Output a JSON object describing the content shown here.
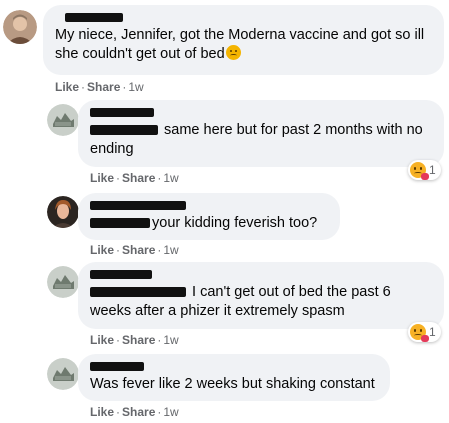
{
  "actions": {
    "like": "Like",
    "share": "Share",
    "separator": "·"
  },
  "comments": [
    {
      "text": "My niece, Jennifer, got the Moderna vaccine and got so ill she couldn't get out of bed",
      "time": "1w"
    },
    {
      "text": "same here but for past 2 months with no ending",
      "time": "1w",
      "reaction_count": "1"
    },
    {
      "text": "your kidding feverish too?",
      "time": "1w"
    },
    {
      "text": "I can't get out of bed the past 6 weeks after a phizer it extremely spasm",
      "time": "1w",
      "reaction_count": "1"
    },
    {
      "text": "Was fever like 2 weeks but shaking constant",
      "time": "1w"
    }
  ],
  "colors": {
    "bubble": "#f0f2f5",
    "meta_text": "#65676b",
    "redaction": "#111111"
  },
  "icons": {
    "reaction": "care-emoji-icon",
    "inline": "angry-face-emoji-icon"
  }
}
